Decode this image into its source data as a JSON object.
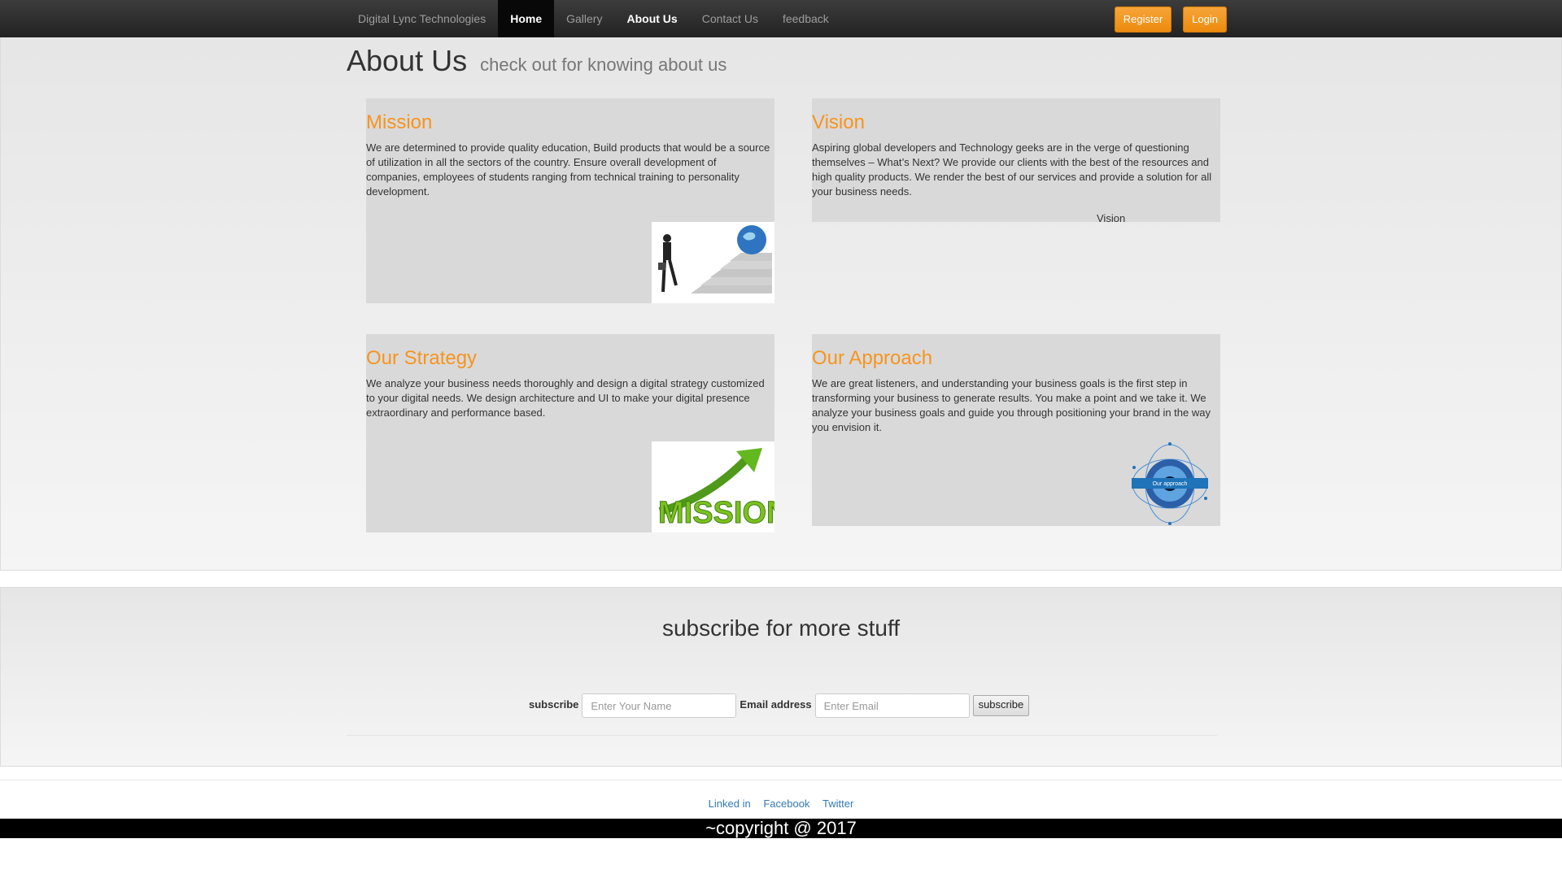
{
  "navbar": {
    "brand": "Digital Lync Technologies",
    "links": [
      "Home",
      "Gallery",
      "About Us",
      "Contact Us",
      "feedback"
    ],
    "active": "Home",
    "register_label": "Register",
    "login_label": "Login",
    "button_color": "#f0941d"
  },
  "about": {
    "title": "About Us",
    "subtitle": "check out for knowing about us",
    "cards": [
      {
        "title": "Mission",
        "text": "We are determined to provide quality education, Build products that would be a source of utilization in all the sectors of the country. Ensure overall development of companies, employees of students ranging from technical training to personality development."
      },
      {
        "title": "Vision",
        "text": "Aspiring global developers and Technology geeks are in the verge of questioning themselves – What’s Next? We provide our clients with the best of the resources and high quality products. We render the best of our services and provide a solution for all your business needs.",
        "caption": "Vision"
      },
      {
        "title": "Our Strategy",
        "text": "We analyze your business needs thoroughly and design a digital strategy customized to your digital needs. We design architecture and UI to make your digital presence extraordinary and performance based."
      },
      {
        "title": "Our Approach",
        "text": "We are great listeners, and understanding your business goals is the first step in transforming your business to generate results. You make a point and we take it. We analyze your business goals and guide you through positioning your brand in the way you envision it."
      }
    ],
    "images": {
      "mission_word": "MISSION",
      "approach_badge": "Our approach"
    },
    "title_color": "#f7941d"
  },
  "subscribe": {
    "title": "subscribe for more stuff",
    "name_label": "subscribe",
    "name_placeholder": "Enter Your Name",
    "email_label": "Email address",
    "email_placeholder": "Enter Email",
    "button_label": "subscribe"
  },
  "footer": {
    "links": [
      "Linked in",
      "Facebook",
      "Twitter"
    ],
    "copyright": "~copyright @ 2017"
  }
}
